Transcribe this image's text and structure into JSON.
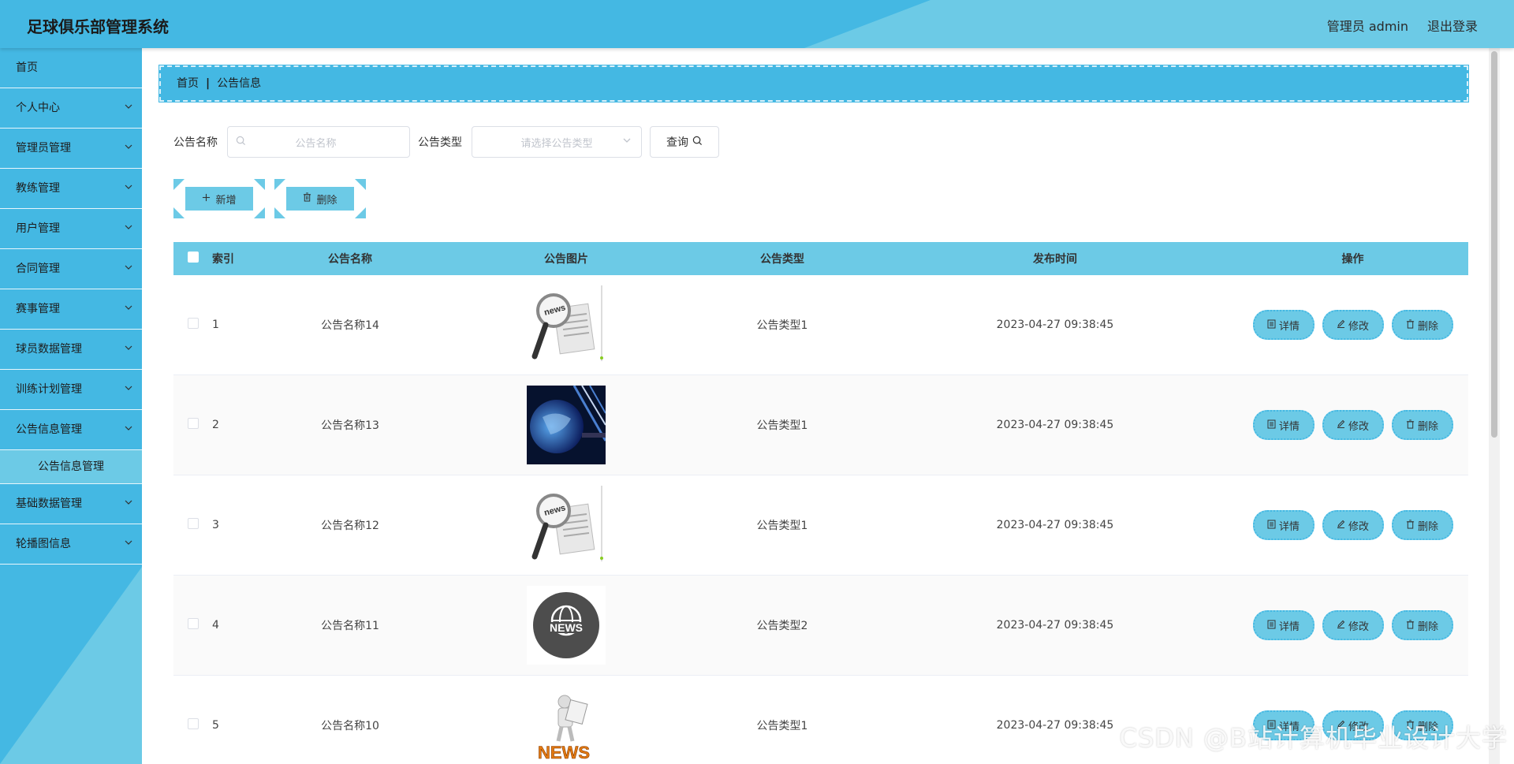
{
  "header": {
    "title": "足球俱乐部管理系统",
    "admin_label": "管理员 admin",
    "logout_label": "退出登录"
  },
  "sidebar": {
    "items": [
      {
        "label": "首页",
        "has_children": false
      },
      {
        "label": "个人中心",
        "has_children": true
      },
      {
        "label": "管理员管理",
        "has_children": true
      },
      {
        "label": "教练管理",
        "has_children": true
      },
      {
        "label": "用户管理",
        "has_children": true
      },
      {
        "label": "合同管理",
        "has_children": true
      },
      {
        "label": "赛事管理",
        "has_children": true
      },
      {
        "label": "球员数据管理",
        "has_children": true
      },
      {
        "label": "训练计划管理",
        "has_children": true
      },
      {
        "label": "公告信息管理",
        "has_children": true
      },
      {
        "label": "公告信息管理",
        "is_sub": true
      },
      {
        "label": "基础数据管理",
        "has_children": true
      },
      {
        "label": "轮播图信息",
        "has_children": true
      }
    ]
  },
  "breadcrumb": {
    "home": "首页",
    "current": "公告信息"
  },
  "search": {
    "name_label": "公告名称",
    "name_placeholder": "公告名称",
    "type_label": "公告类型",
    "type_placeholder": "请选择公告类型",
    "query_label": "查询"
  },
  "actions": {
    "add_label": "新增",
    "delete_label": "删除"
  },
  "table": {
    "headers": {
      "index": "索引",
      "name": "公告名称",
      "image": "公告图片",
      "type": "公告类型",
      "time": "发布时间",
      "ops": "操作"
    },
    "rows": [
      {
        "index": "1",
        "name": "公告名称14",
        "image": "news-magnifier",
        "type": "公告类型1",
        "time": "2023-04-27 09:38:45"
      },
      {
        "index": "2",
        "name": "公告名称13",
        "image": "globe-tech",
        "type": "公告类型1",
        "time": "2023-04-27 09:38:45"
      },
      {
        "index": "3",
        "name": "公告名称12",
        "image": "news-magnifier",
        "type": "公告类型1",
        "time": "2023-04-27 09:38:45"
      },
      {
        "index": "4",
        "name": "公告名称11",
        "image": "news-globe-badge",
        "type": "公告类型2",
        "time": "2023-04-27 09:38:45"
      },
      {
        "index": "5",
        "name": "公告名称10",
        "image": "news-figure",
        "type": "公告类型1",
        "time": "2023-04-27 09:38:45"
      }
    ],
    "row_ops": {
      "detail": "详情",
      "edit": "修改",
      "delete": "删除"
    }
  },
  "watermark": "CSDN @B站计算机毕业设计大学",
  "colors": {
    "primary": "#44b8e3",
    "light": "#6ccae6"
  }
}
